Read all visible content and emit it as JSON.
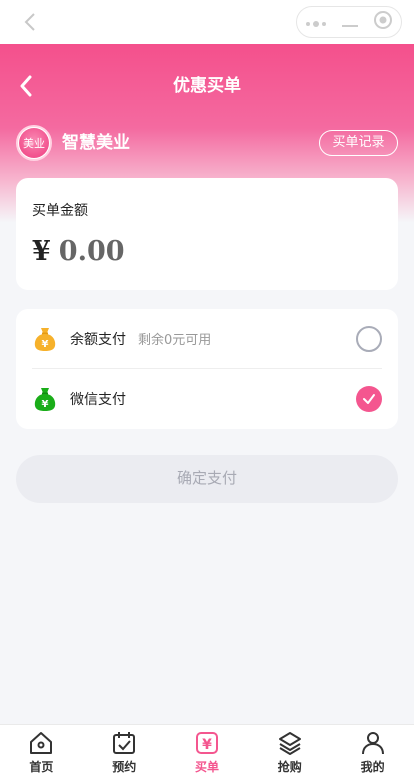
{
  "nav": {
    "title": "优惠买单"
  },
  "shop": {
    "logo_text": "美业",
    "name": "智慧美业",
    "record_label": "买单记录"
  },
  "amount": {
    "label": "买单金额",
    "currency": "¥",
    "value": "0.00"
  },
  "payment": {
    "options": [
      {
        "name": "余额支付",
        "sub": "剩余0元可用",
        "selected": false,
        "icon": "money-bag-icon",
        "color": "#f6b12b"
      },
      {
        "name": "微信支付",
        "sub": "",
        "selected": true,
        "icon": "money-bag-icon",
        "color": "#1aad19"
      }
    ]
  },
  "confirm": {
    "label": "确定支付"
  },
  "tabbar": {
    "items": [
      {
        "label": "首页",
        "icon": "home-icon",
        "active": false
      },
      {
        "label": "预约",
        "icon": "calendar-check-icon",
        "active": false
      },
      {
        "label": "买单",
        "icon": "yen-icon",
        "active": true
      },
      {
        "label": "抢购",
        "icon": "layers-icon",
        "active": false
      },
      {
        "label": "我的",
        "icon": "user-icon",
        "active": false
      }
    ]
  },
  "colors": {
    "accent": "#f4568f",
    "gradient_top": "#f4508c",
    "background": "#f5f6f9"
  }
}
